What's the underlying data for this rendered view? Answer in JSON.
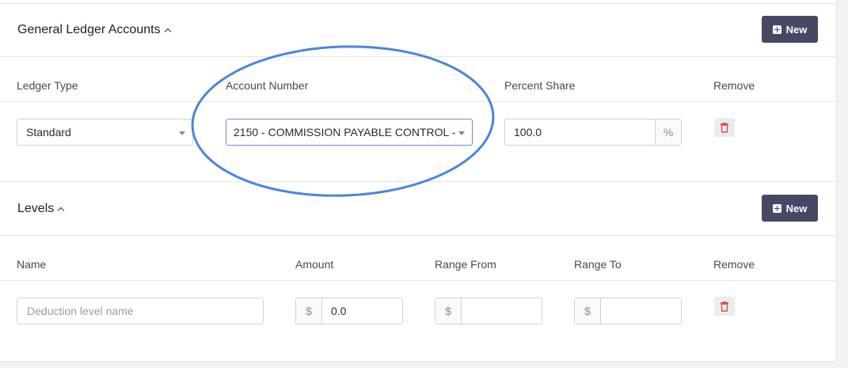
{
  "gl_section": {
    "title": "General Ledger Accounts",
    "new_label": "New",
    "columns": {
      "ledger_type": "Ledger Type",
      "account_number": "Account Number",
      "percent_share": "Percent Share",
      "remove": "Remove"
    },
    "row": {
      "ledger_type": "Standard",
      "account_number": "2150 - COMMISSION PAYABLE CONTROL - ...",
      "percent_share": "100.0",
      "percent_symbol": "%"
    }
  },
  "levels_section": {
    "title": "Levels",
    "new_label": "New",
    "columns": {
      "name": "Name",
      "amount": "Amount",
      "range_from": "Range From",
      "range_to": "Range To",
      "remove": "Remove"
    },
    "row": {
      "name_placeholder": "Deduction level name",
      "amount": "0.0",
      "currency_symbol": "$",
      "range_from": "",
      "range_to": ""
    }
  },
  "colors": {
    "button_bg": "#454963",
    "trash_red": "#d9534f",
    "annotation_blue": "#4a86d9"
  },
  "icons": {
    "new_button": "plus-square-icon",
    "remove": "trash-icon",
    "collapse": "chevron-up-icon",
    "dropdown": "caret-down-icon"
  }
}
